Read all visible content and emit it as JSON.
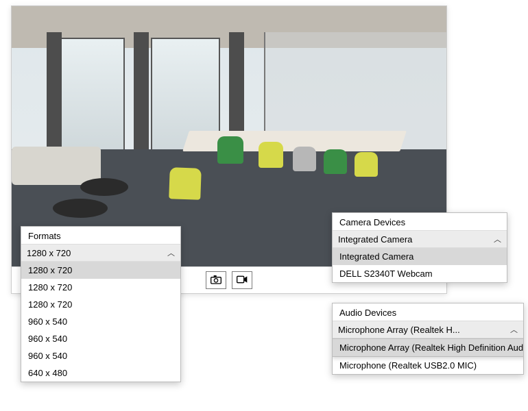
{
  "toolbar": {
    "snapshot_tooltip": "Take Snapshot",
    "record_tooltip": "Record Video"
  },
  "formats": {
    "title": "Formats",
    "selected": "1280 x 720",
    "options": [
      "1280 x 720",
      "1280 x 720",
      "1280 x 720",
      "960 x 540",
      "960 x 540",
      "960 x 540",
      "640 x 480"
    ],
    "selected_index": 0
  },
  "camera": {
    "title": "Camera Devices",
    "selected": "Integrated Camera",
    "options": [
      "Integrated Camera",
      "DELL S2340T Webcam"
    ],
    "selected_index": 0
  },
  "audio": {
    "title": "Audio Devices",
    "selected": "Microphone Array (Realtek H...",
    "selected_full": "Microphone Array (Realtek High Definition Audio)",
    "options": [
      "Microphone Array (Realtek High Definition Audio)",
      "Microphone (Realtek USB2.0 MIC)"
    ],
    "selected_index": 0
  }
}
